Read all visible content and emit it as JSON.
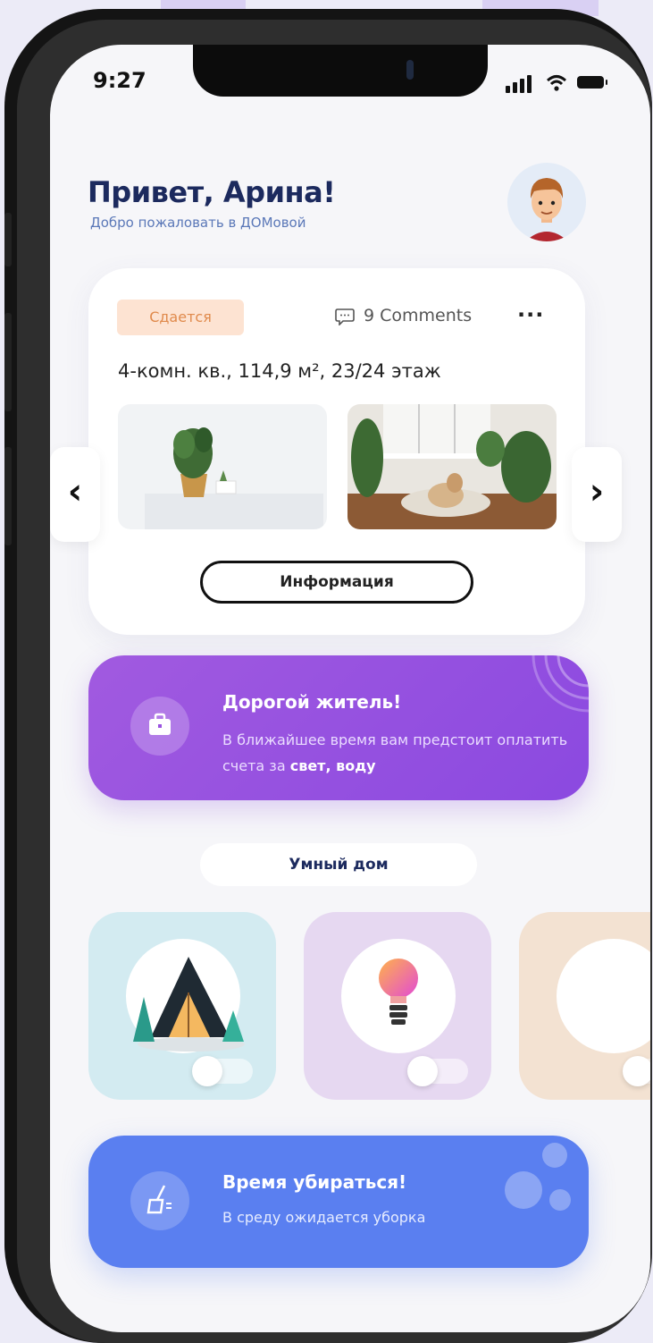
{
  "status_bar": {
    "time": "9:27"
  },
  "header": {
    "greeting": "Привет, Арина!",
    "welcome": "Добро пожаловать в  ДОМовой"
  },
  "listing": {
    "tag": "Сдается",
    "comments": "9 Comments",
    "more": "···",
    "description": "4-комн. кв., 114,9 м², 23/24 этаж",
    "info_button": "Информация",
    "prev": "‹",
    "next": "›"
  },
  "notice": {
    "title": "Дорогой житель!",
    "text_before": "В ближайшее время вам предстоит оплатить счета за ",
    "text_bold": "свет, воду"
  },
  "smart_home": {
    "title": "Умный дом",
    "devices": [
      {
        "icon": "a-frame-house-icon",
        "color": "#d3ebf1",
        "on": false
      },
      {
        "icon": "lightbulb-icon",
        "color": "#e6d8f1",
        "on": false
      },
      {
        "icon": "device-icon",
        "color": "#f3e2d2",
        "on": false
      }
    ]
  },
  "cleaning": {
    "title": "Время убираться!",
    "text": "В среду ожидается уборка"
  },
  "colors": {
    "notice_bg": "#9a52e0",
    "cleaning_bg": "#5a7ff0",
    "tag_bg": "#fde3d2",
    "heading": "#1c2a5e"
  }
}
